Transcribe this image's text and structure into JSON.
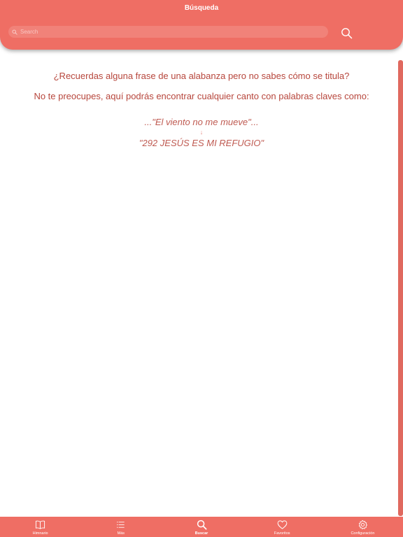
{
  "header": {
    "title": "Búsqueda",
    "search": {
      "placeholder": "Search",
      "value": ""
    }
  },
  "main": {
    "question": "¿Recuerdas alguna frase de una alabanza pero no sabes cómo se titula?",
    "explanation": "No te preocupes, aquí podrás encontrar cualquier canto con palabras claves como:",
    "example_phrase": "...\"El viento no me mueve\"...",
    "arrow": "↓",
    "example_title": "\"292 JESÚS ES MI REFUGIO\""
  },
  "tabbar": {
    "items": [
      {
        "label": "Himnario",
        "icon": "book-icon",
        "active": false
      },
      {
        "label": "Más",
        "icon": "list-icon",
        "active": false
      },
      {
        "label": "Buscar",
        "icon": "search-icon",
        "active": true
      },
      {
        "label": "Favoritos",
        "icon": "heart-icon",
        "active": false
      },
      {
        "label": "Configuración",
        "icon": "gear-icon",
        "active": false
      }
    ]
  },
  "colors": {
    "accent": "#ef6e64",
    "text_primary": "#b7463c",
    "text_example": "#bf5a51",
    "background": "#ffffff"
  }
}
